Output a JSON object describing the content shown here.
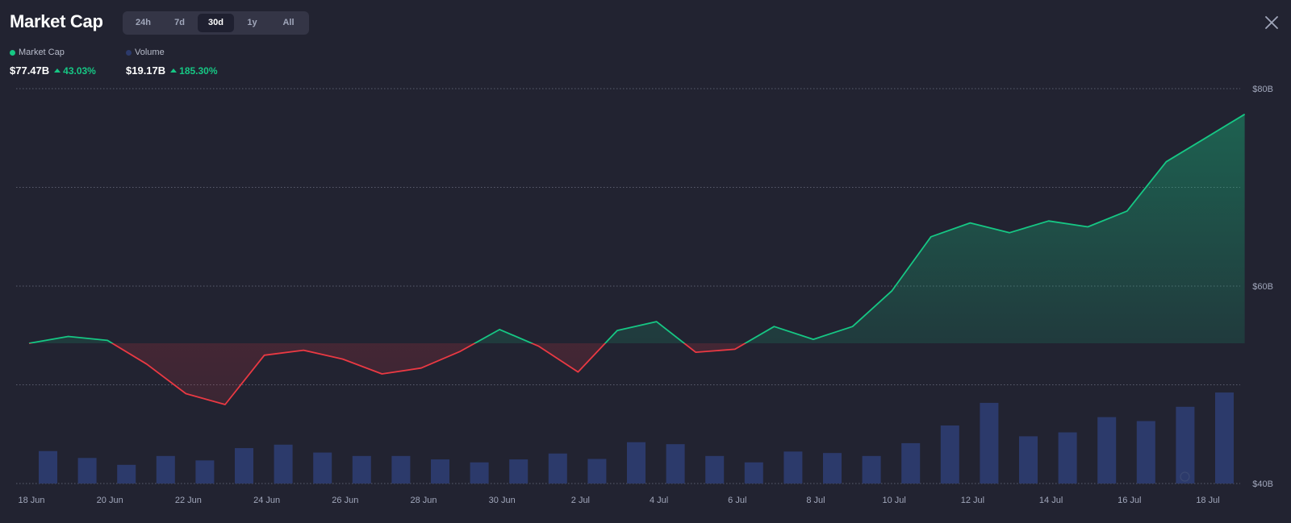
{
  "header": {
    "title": "Market Cap",
    "close_icon": "close-icon"
  },
  "range_tabs": [
    {
      "label": "24h",
      "active": false
    },
    {
      "label": "7d",
      "active": false
    },
    {
      "label": "30d",
      "active": true
    },
    {
      "label": "1y",
      "active": false
    },
    {
      "label": "All",
      "active": false
    }
  ],
  "legend": {
    "market_cap": {
      "name": "Market Cap",
      "value": "$77.47B",
      "change": "43.03%",
      "color": "#16c784"
    },
    "volume": {
      "name": "Volume",
      "value": "$19.17B",
      "change": "185.30%",
      "color": "#2c3a6b"
    }
  },
  "colors": {
    "up": "#16c784",
    "down": "#ea3943",
    "volume_bar": "#2c3a6b",
    "grid": "#8a8ea0"
  },
  "chart_data": {
    "type": "line",
    "title": "Market Cap",
    "baseline": 54.2,
    "x": [
      "18 Jun",
      "19 Jun",
      "20 Jun",
      "21 Jun",
      "22 Jun",
      "23 Jun",
      "24 Jun",
      "25 Jun",
      "26 Jun",
      "27 Jun",
      "28 Jun",
      "29 Jun",
      "30 Jun",
      "1 Jul",
      "2 Jul",
      "3 Jul",
      "4 Jul",
      "5 Jul",
      "6 Jul",
      "7 Jul",
      "8 Jul",
      "9 Jul",
      "10 Jul",
      "11 Jul",
      "12 Jul",
      "13 Jul",
      "14 Jul",
      "15 Jul",
      "16 Jul",
      "17 Jul",
      "18 Jul",
      "19 Jul"
    ],
    "x_tick_labels": [
      "18 Jun",
      "20 Jun",
      "22 Jun",
      "24 Jun",
      "26 Jun",
      "28 Jun",
      "30 Jun",
      "2 Jul",
      "4 Jul",
      "6 Jul",
      "8 Jul",
      "10 Jul",
      "12 Jul",
      "14 Jul",
      "16 Jul",
      "18 Jul"
    ],
    "y_ticks": [
      "$80B",
      "$60B",
      "$40B"
    ],
    "y_tick_values": [
      80,
      60,
      40
    ],
    "ylim": [
      40,
      80
    ],
    "grid": true,
    "series": [
      {
        "name": "Market Cap",
        "unit": "B USD",
        "values": [
          54.2,
          54.9,
          54.5,
          52.1,
          49.1,
          48.0,
          53.0,
          53.5,
          52.6,
          51.1,
          51.7,
          53.4,
          55.6,
          53.9,
          51.3,
          55.5,
          56.4,
          53.3,
          53.6,
          55.9,
          54.6,
          55.9,
          59.5,
          65.0,
          66.4,
          65.4,
          66.6,
          66.0,
          67.6,
          72.6,
          75.0,
          77.4
        ]
      },
      {
        "name": "Volume",
        "unit": "B USD",
        "values": [
          6.6,
          5.2,
          3.8,
          5.6,
          4.7,
          7.2,
          7.9,
          6.3,
          5.6,
          5.6,
          4.9,
          4.3,
          4.9,
          6.1,
          5.0,
          8.4,
          8.0,
          5.6,
          4.3,
          6.5,
          6.2,
          5.6,
          8.2,
          11.8,
          16.4,
          9.6,
          10.4,
          13.5,
          12.7,
          15.6,
          18.5
        ]
      }
    ]
  }
}
